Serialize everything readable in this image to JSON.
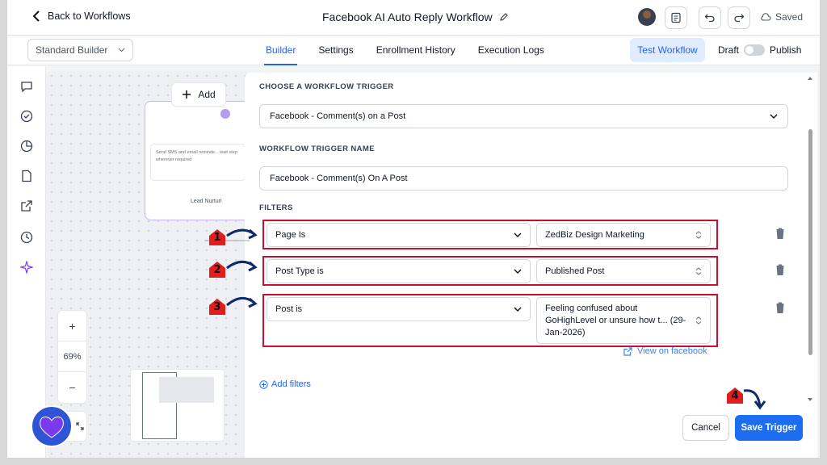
{
  "header": {
    "back_label": "Back to Workflows",
    "workflow_title": "Facebook AI Auto Reply Workflow",
    "saved_label": "Saved"
  },
  "subbar": {
    "builder_select": "Standard Builder",
    "tabs": [
      {
        "label": "Builder",
        "active": true
      },
      {
        "label": "Settings",
        "active": false
      },
      {
        "label": "Enrollment History",
        "active": false
      },
      {
        "label": "Execution Logs",
        "active": false
      }
    ],
    "test_label": "Test Workflow",
    "draft_label": "Draft",
    "publish_label": "Publish"
  },
  "canvas": {
    "add_label": "Add",
    "node_text": "Send SMS and email reminde... wait step wherever required",
    "node_footer": "Lead Nurturi",
    "zoom_level": "69%"
  },
  "panel": {
    "trigger_section": "CHOOSE A WORKFLOW TRIGGER",
    "trigger_value": "Facebook - Comment(s) on a Post",
    "name_section": "WORKFLOW TRIGGER NAME",
    "name_value": "Facebook - Comment(s) On A Post",
    "filters_section": "FILTERS",
    "filters": [
      {
        "field": "Page Is",
        "value": "ZedBiz Design Marketing"
      },
      {
        "field": "Post Type is",
        "value": "Published Post"
      },
      {
        "field": "Post is",
        "value": "Feeling confused about GoHighLevel or unsure how t... (29-Jan-2026)"
      }
    ],
    "view_link": "View on facebook",
    "add_filters": "Add filters",
    "cancel_label": "Cancel",
    "save_label": "Save Trigger"
  },
  "markers": [
    "1",
    "2",
    "3",
    "4"
  ],
  "colors": {
    "accent": "#2563eb",
    "annotation_red": "#c8102e",
    "annotation_arrow": "#0f2a6b"
  }
}
